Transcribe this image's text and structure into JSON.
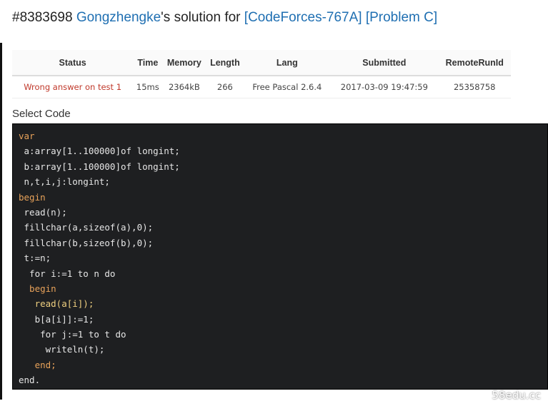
{
  "header": {
    "run_id": "#8383698",
    "user": "Gongzhengke",
    "suffix": "'s solution for",
    "problem_link": "[CodeForces-767A]",
    "problem_label": "[Problem C]"
  },
  "submission_table": {
    "columns": [
      "Status",
      "Time",
      "Memory",
      "Length",
      "Lang",
      "Submitted",
      "RemoteRunId"
    ],
    "row": {
      "status": "Wrong answer on test 1",
      "time": "15ms",
      "memory": "2364kB",
      "length": "266",
      "lang": "Free Pascal 2.6.4",
      "submitted": "2017-03-09 19:47:59",
      "remote_run_id": "25358758"
    }
  },
  "select_code_label": "Select Code",
  "code_lines": [
    "var",
    " a:array[1..100000]of longint;",
    " b:array[1..100000]of longint;",
    " n,t,i,j:longint;",
    "begin",
    " read(n);",
    " fillchar(a,sizeof(a),0);",
    " fillchar(b,sizeof(b),0);",
    " t:=n;",
    "  for i:=1 to n do",
    "  begin",
    "   read(a[i]);",
    "   b[a[i]]:=1;",
    "    for j:=1 to t do",
    "     writeln(t);",
    "   end;",
    "end."
  ],
  "watermark": "58edu.cc",
  "colors": {
    "link": "#1f6fb2",
    "status_error": "#c0392b",
    "code_bg": "#1e1f21",
    "keyword": "#e8a25a"
  }
}
